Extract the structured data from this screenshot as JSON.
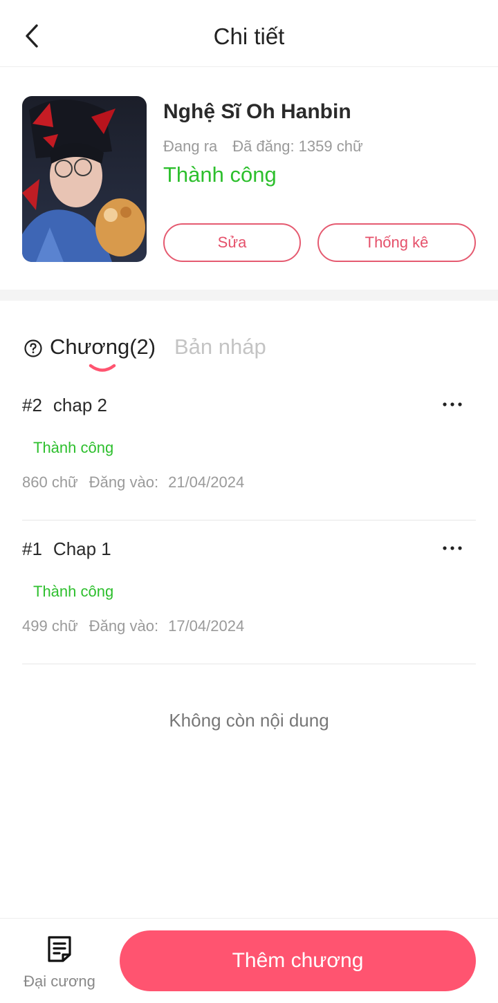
{
  "header": {
    "title": "Chi tiết"
  },
  "book": {
    "title": "Nghệ Sĩ Oh Hanbin",
    "progress": "Đang ra",
    "posted_label": "Đã đăng: 1359 chữ",
    "status": "Thành công",
    "edit_label": "Sửa",
    "stats_label": "Thống kê"
  },
  "tabs": {
    "chapters_label": "Chương(2)",
    "drafts_label": "Bản nháp"
  },
  "chapters": [
    {
      "number": "#2",
      "title": "chap 2",
      "status": "Thành công",
      "words": "860 chữ",
      "posted_label": "Đăng vào:",
      "date": "21/04/2024"
    },
    {
      "number": "#1",
      "title": "Chap 1",
      "status": "Thành công",
      "words": "499 chữ",
      "posted_label": "Đăng vào:",
      "date": "17/04/2024"
    }
  ],
  "list_end": "Không còn nội dung",
  "bottom": {
    "outline_label": "Đại cương",
    "add_label": "Thêm chương"
  },
  "colors": {
    "accent": "#ff5470",
    "success": "#2dbf2d",
    "muted": "#9a9a9a"
  },
  "icons": [
    "back-arrow-icon",
    "help-icon",
    "more-icon",
    "outline-icon"
  ]
}
